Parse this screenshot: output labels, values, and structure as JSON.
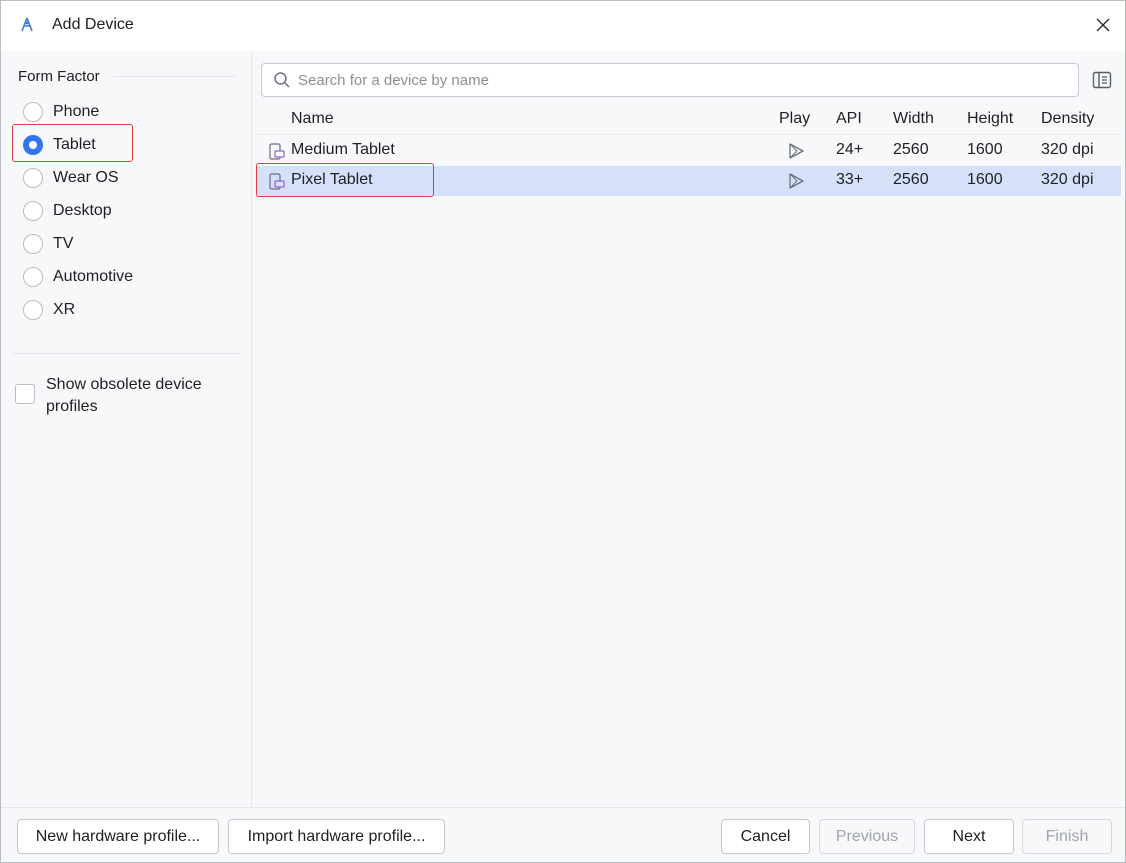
{
  "window": {
    "title": "Add Device"
  },
  "form_factor": {
    "header": "Form Factor",
    "options": [
      {
        "label": "Phone",
        "checked": false
      },
      {
        "label": "Tablet",
        "checked": true
      },
      {
        "label": "Wear OS",
        "checked": false
      },
      {
        "label": "Desktop",
        "checked": false
      },
      {
        "label": "TV",
        "checked": false
      },
      {
        "label": "Automotive",
        "checked": false
      },
      {
        "label": "XR",
        "checked": false
      }
    ],
    "show_obsolete_label": "Show obsolete device profiles",
    "show_obsolete_checked": false
  },
  "search": {
    "placeholder": "Search for a device by name",
    "value": ""
  },
  "table": {
    "columns": [
      "Name",
      "Play",
      "API",
      "Width",
      "Height",
      "Density"
    ],
    "rows": [
      {
        "name": "Medium Tablet",
        "play": "play-store-icon",
        "api": "24+",
        "width": "2560",
        "height": "1600",
        "density": "320 dpi",
        "selected": false
      },
      {
        "name": "Pixel Tablet",
        "play": "play-store-icon",
        "api": "33+",
        "width": "2560",
        "height": "1600",
        "density": "320 dpi",
        "selected": true
      }
    ]
  },
  "footer": {
    "new_hw": "New hardware profile...",
    "import_hw": "Import hardware profile...",
    "cancel": "Cancel",
    "previous": "Previous",
    "next": "Next",
    "finish": "Finish"
  },
  "colors": {
    "accent": "#3574f0",
    "selection": "#d5e1fb",
    "highlight": "#e0403c"
  },
  "icons": [
    "android-studio-icon",
    "close-icon",
    "search-icon",
    "panel-toggle-icon",
    "tablet-device-icon",
    "play-store-icon"
  ]
}
